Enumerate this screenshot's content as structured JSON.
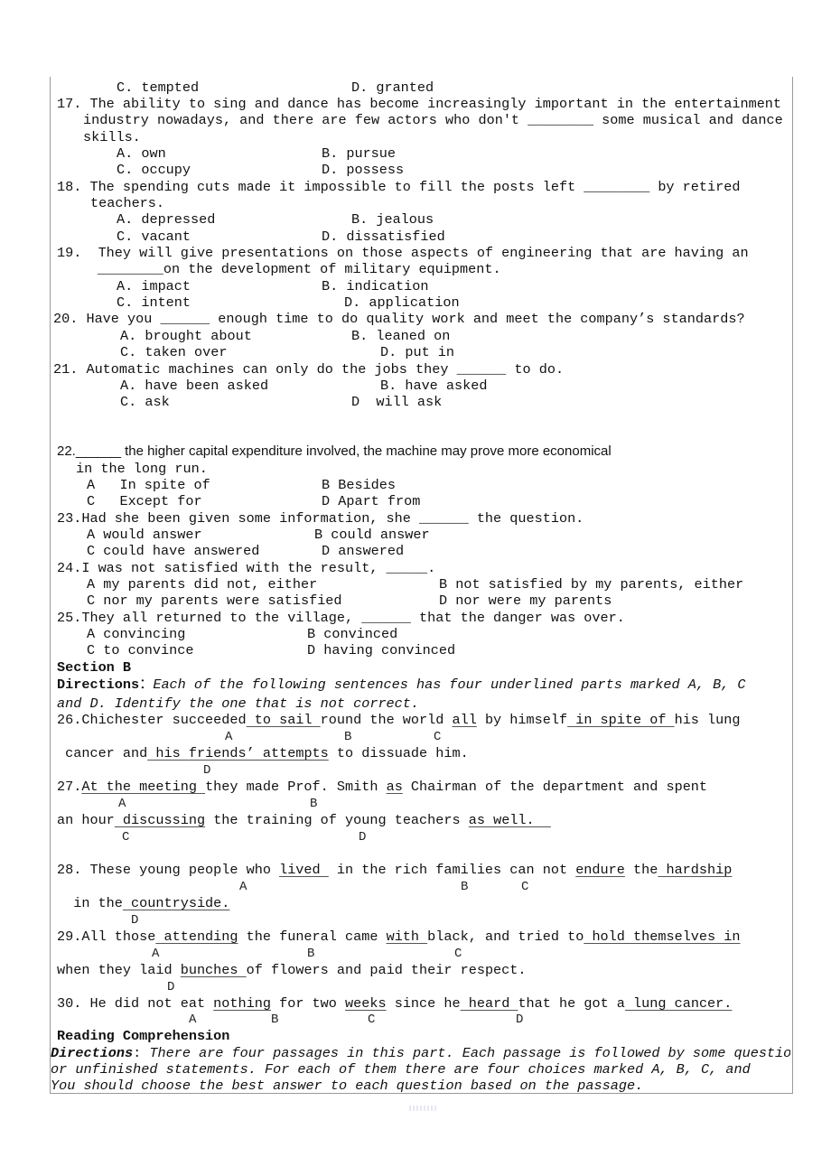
{
  "q16": {
    "opt_c": "C. tempted",
    "opt_d": "D. granted"
  },
  "q17": {
    "line1": "17. The ability to sing and dance has become increasingly important in the entertainment",
    "line2": "industry nowadays, and there are few actors who don't ________ some musical and dance",
    "line3": "skills.",
    "opt_a": "A. own",
    "opt_b": "B. pursue",
    "opt_c": "C. occupy",
    "opt_d": "D. possess"
  },
  "q18": {
    "line1": "18. The spending cuts made it impossible to fill the posts left ________ by retired",
    "line2": "teachers.",
    "opt_a": "A. depressed",
    "opt_b": "B. jealous",
    "opt_c": "C. vacant",
    "opt_d": "D. dissatisfied"
  },
  "q19": {
    "line1": "19.  They will give presentations on those aspects of engineering that are having an",
    "line2": "________on the development of military equipment.",
    "opt_a": "A. impact",
    "opt_b": "B. indication",
    "opt_c": "C. intent",
    "opt_d": "D. application"
  },
  "q20": {
    "line1": "20. Have you ______ enough time to do quality work and meet the company’s standards?",
    "opt_a": "A. brought about",
    "opt_b": "B. leaned on",
    "opt_c": "C. taken over",
    "opt_d": "D. put in"
  },
  "q21": {
    "line1": "21. Automatic machines can only do the jobs they ______ to do.",
    "opt_a": "A. have been asked",
    "opt_b": "B. have asked",
    "opt_c": "C. ask",
    "opt_d": "D  will ask"
  },
  "q22": {
    "line1": "22.______ the higher capital expenditure involved, the machine may prove more economical",
    "line2": "in the long run.",
    "opt_a": "A   In spite of",
    "opt_b": "B Besides",
    "opt_c": "C   Except for",
    "opt_d": "D Apart from"
  },
  "q23": {
    "line1": "23.Had she been given some information, she ______ the question.",
    "opt_a": "A would answer",
    "opt_b": "B could answer",
    "opt_c": "C could have answered",
    "opt_d": "D answered"
  },
  "q24": {
    "line1": "24.I was not satisfied with the result, _____.",
    "opt_a": "A my parents did not, either",
    "opt_b": "B not satisfied by my parents, either",
    "opt_c": "C nor my parents were satisfied",
    "opt_d": "D nor were my parents"
  },
  "q25": {
    "line1": "25.They all returned to the village, ______ that the danger was over.",
    "opt_a": "A convincing",
    "opt_b": "B convinced",
    "opt_c": "C to convince",
    "opt_d": "D having convinced"
  },
  "section_b": {
    "heading": "Section B",
    "directions_label": "Directions",
    "directions_colon": "：",
    "directions_line1": "Each of the following sentences has four underlined parts marked A, B, C",
    "directions_line2": "and D. Identify the one that is not correct."
  },
  "q26": {
    "l1": [
      "26.Chichester succeeded",
      " to sail ",
      "round the world ",
      "all",
      " by himself",
      " in spite of ",
      "his lung"
    ],
    "l2": [
      " cancer and",
      " his ",
      " ",
      "friends’ attempts",
      " to dissuade him."
    ],
    "labels": [
      "A",
      "B",
      "C",
      "D"
    ]
  },
  "q27": {
    "l1": [
      "27.",
      "At the meeting ",
      "they made Prof. Smith ",
      "as",
      " Chairman of the department and spent"
    ],
    "l2": [
      "an hour",
      " discussing",
      " the training of young teachers ",
      "as well.  "
    ],
    "labels": [
      "A",
      "B",
      "C",
      "D"
    ]
  },
  "q28": {
    "l1": [
      "28. These young people who ",
      "lived ",
      " in the rich families can not ",
      "endure",
      " the",
      " hardship"
    ],
    "l2": [
      "  in the",
      " countryside."
    ],
    "labels": [
      "A",
      "B",
      "C",
      "D"
    ]
  },
  "q29": {
    "l1": [
      "29.All those",
      " attending",
      " the funeral came ",
      "with ",
      "black, and tried to",
      " hold themselves in"
    ],
    "l2": [
      "when they laid ",
      "bunches ",
      "of flowers and paid their respect."
    ],
    "labels": [
      "A",
      "B",
      "C",
      "D"
    ]
  },
  "q30": {
    "l1": [
      "30. He did not eat ",
      "nothing",
      " for two ",
      "weeks",
      " since he",
      " heard ",
      "that he got a",
      " lung cancer."
    ],
    "labels": [
      "A",
      "B",
      "C",
      "D"
    ]
  },
  "reading": {
    "heading": "Reading Comprehension",
    "directions_label": "Directions",
    "directions_colon": ":",
    "line1": " There are four passages in this part. Each passage is followed by some questio",
    "line2": "or unfinished statements. For each of them there are four choices marked A, B, C, and",
    "line3": "You should choose the best answer to each question based on the passage."
  }
}
